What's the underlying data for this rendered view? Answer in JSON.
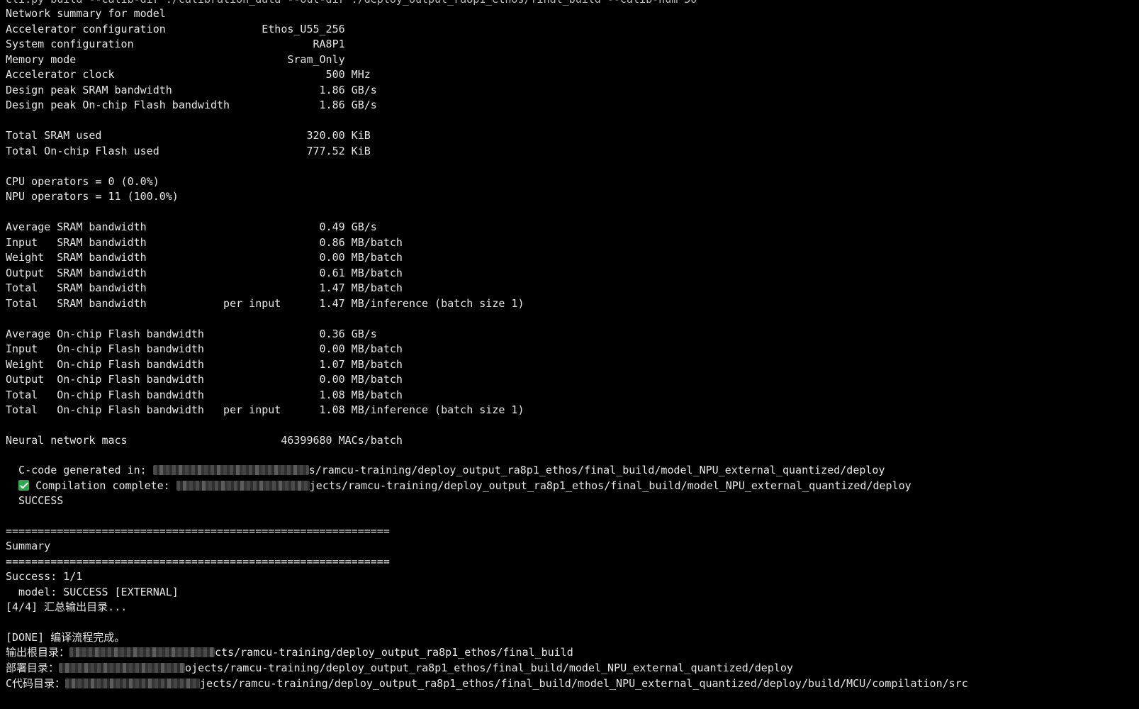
{
  "terminal": {
    "clipped_top": "cli.py build --calib-dir ./calibration_data --out-dir ./deploy_output_ra8p1_ethos/final_build --calib-num 50",
    "lines": [
      "Network summary for model",
      "Accelerator configuration               Ethos_U55_256",
      "System configuration                            RA8P1",
      "Memory mode                                 Sram_Only",
      "Accelerator clock                                 500 MHz",
      "Design peak SRAM bandwidth                       1.86 GB/s",
      "Design peak On-chip Flash bandwidth              1.86 GB/s",
      "",
      "Total SRAM used                                320.00 KiB",
      "Total On-chip Flash used                       777.52 KiB",
      "",
      "CPU operators = 0 (0.0%)",
      "NPU operators = 11 (100.0%)",
      "",
      "Average SRAM bandwidth                           0.49 GB/s",
      "Input   SRAM bandwidth                           0.86 MB/batch",
      "Weight  SRAM bandwidth                           0.00 MB/batch",
      "Output  SRAM bandwidth                           0.61 MB/batch",
      "Total   SRAM bandwidth                           1.47 MB/batch",
      "Total   SRAM bandwidth            per input      1.47 MB/inference (batch size 1)",
      "",
      "Average On-chip Flash bandwidth                  0.36 GB/s",
      "Input   On-chip Flash bandwidth                  0.00 MB/batch",
      "Weight  On-chip Flash bandwidth                  1.07 MB/batch",
      "Output  On-chip Flash bandwidth                  0.00 MB/batch",
      "Total   On-chip Flash bandwidth                  1.08 MB/batch",
      "Total   On-chip Flash bandwidth   per input      1.08 MB/inference (batch size 1)",
      "",
      "Neural network macs                        46399680 MACs/batch",
      ""
    ],
    "codegen": {
      "label": "  C-code generated in: ",
      "path_tail": "s/ramcu-training/deploy_output_ra8p1_ethos/final_build/model_NPU_external_quantized/deploy"
    },
    "compile": {
      "label": " Compilation complete: ",
      "path_tail": "jects/ramcu-training/deploy_output_ra8p1_ethos/final_build/model_NPU_external_quantized/deploy",
      "icon": "check-mark-icon",
      "icon_color": "#2fa84f"
    },
    "status": "  SUCCESS",
    "summary_lines": [
      "",
      "============================================================",
      "Summary",
      "============================================================",
      "Success: 1/1",
      "  model: SUCCESS [EXTERNAL]",
      "[4/4] 汇总输出目录...",
      "",
      "[DONE] 编译流程完成。"
    ],
    "outputs": [
      {
        "label": "输出根目录：",
        "path_tail": "cts/ramcu-training/deploy_output_ra8p1_ethos/final_build"
      },
      {
        "label": "部署目录：",
        "path_tail": "ojects/ramcu-training/deploy_output_ra8p1_ethos/final_build/model_NPU_external_quantized/deploy"
      },
      {
        "label": "C代码目录：",
        "path_tail": "jects/ramcu-training/deploy_output_ra8p1_ethos/final_build/model_NPU_external_quantized/deploy/build/MCU/compilation/src"
      }
    ]
  },
  "colors": {
    "background": "#000000",
    "foreground": "#e6e6e6"
  }
}
